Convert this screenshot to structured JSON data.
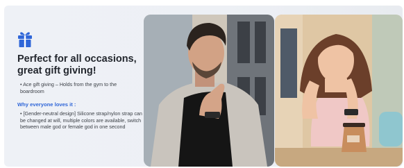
{
  "section": {
    "title": "Perfect for all occasions, great gift giving!",
    "bullet_1": "• Ace gift giving – Holds from the gym to the boardroom",
    "subheading": "Why everyone loves it :",
    "bullet_2": "• [Gender-neutral design] Silicone strap/nylon strap can be changed at will, multiple colors are available, switch between male god or female god in one second"
  },
  "icons": {
    "gift": "gift-icon"
  },
  "colors": {
    "accent_blue": "#2f66d8",
    "title": "#23272e",
    "panel_bg": "#eef1f6"
  }
}
